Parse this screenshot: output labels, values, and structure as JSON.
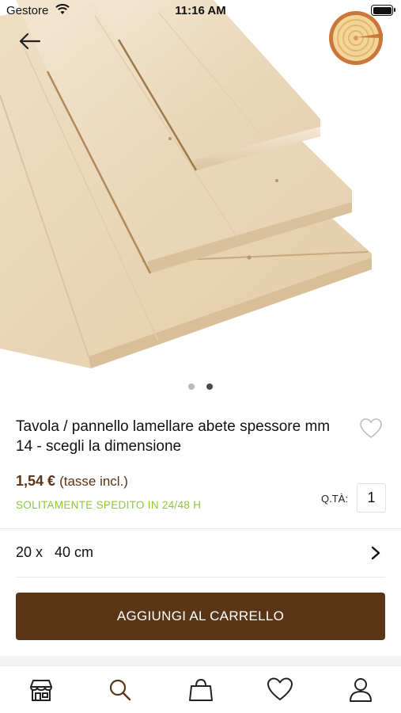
{
  "status_bar": {
    "carrier": "Gestore",
    "time": "11:16 AM"
  },
  "navigation": {
    "back_icon": "arrow-left-icon",
    "logo_icon": "wood-log-logo"
  },
  "gallery": {
    "image_subject": "stacked spruce laminated boards",
    "page_count": 2,
    "current_page": 2
  },
  "product": {
    "title": "Tavola / pannello lamellare abete spessore mm 14 - scegli la dimensione",
    "price": "1,54 €",
    "tax_note": "(tasse incl.)",
    "shipping": "SOLITAMENTE SPEDITO IN 24/48 H",
    "quantity_label": "Q.TÀ:",
    "quantity": "1",
    "favorite_icon": "heart-outline-icon"
  },
  "option": {
    "selected_size": "20 x   40 cm",
    "chevron_icon": "chevron-right-icon"
  },
  "actions": {
    "add_to_cart": "AGGIUNGI AL CARRELLO"
  },
  "tab_bar": {
    "tabs": [
      {
        "icon": "store-icon"
      },
      {
        "icon": "search-icon"
      },
      {
        "icon": "shopping-bag-icon"
      },
      {
        "icon": "heart-icon"
      },
      {
        "icon": "user-icon"
      }
    ]
  },
  "colors": {
    "brand_brown": "#5a3516",
    "price_brown": "#5b3315",
    "shipping_green": "#8cc63f",
    "wood_light": "#efe0c8"
  }
}
